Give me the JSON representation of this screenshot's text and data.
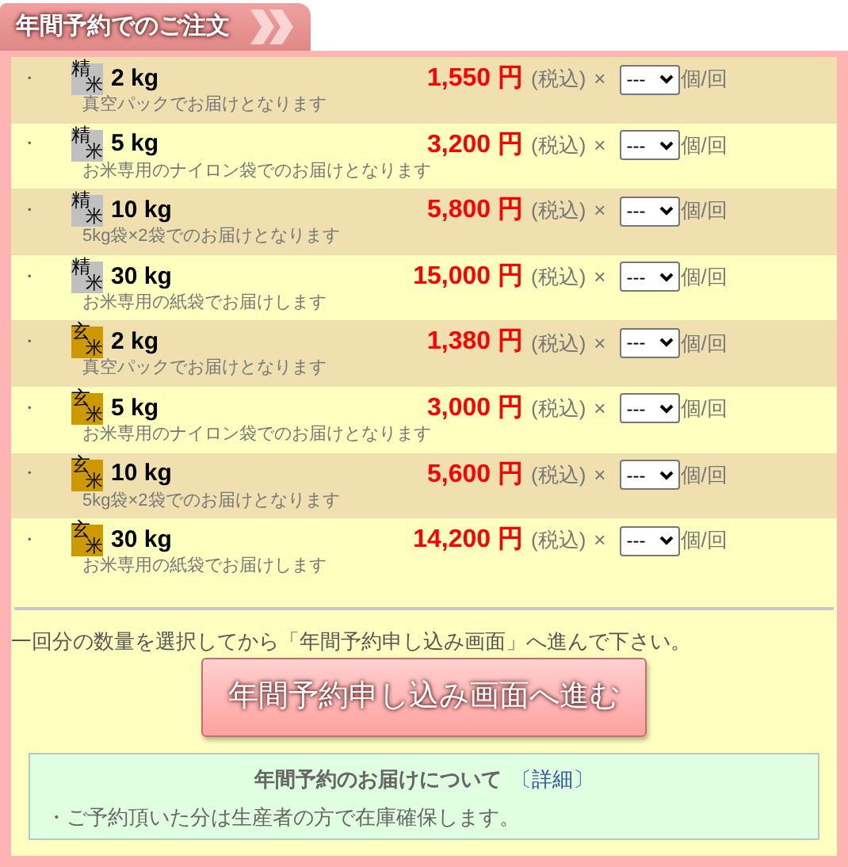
{
  "title": "年間予約でのご注文",
  "items": [
    {
      "bullet": "・",
      "kind": "polished",
      "badge": [
        "精",
        "米"
      ],
      "weight": "2 kg",
      "price": "1,550 円",
      "tax": "(税込)",
      "times": "×",
      "quantity": "---",
      "unit": "個/回",
      "note": "真空パックでお届けとなります"
    },
    {
      "bullet": "・",
      "kind": "polished",
      "badge": [
        "精",
        "米"
      ],
      "weight": "5 kg",
      "price": "3,200 円",
      "tax": "(税込)",
      "times": "×",
      "quantity": "---",
      "unit": "個/回",
      "note": "お米専用のナイロン袋でのお届けとなります"
    },
    {
      "bullet": "・",
      "kind": "polished",
      "badge": [
        "精",
        "米"
      ],
      "weight": "10 kg",
      "price": "5,800 円",
      "tax": "(税込)",
      "times": "×",
      "quantity": "---",
      "unit": "個/回",
      "note": "5kg袋×2袋でのお届けとなります"
    },
    {
      "bullet": "・",
      "kind": "polished",
      "badge": [
        "精",
        "米"
      ],
      "weight": "30 kg",
      "price": "15,000 円",
      "tax": "(税込)",
      "times": "×",
      "quantity": "---",
      "unit": "個/回",
      "note": "お米専用の紙袋でお届けします"
    },
    {
      "bullet": "・",
      "kind": "brown",
      "badge": [
        "玄",
        "米"
      ],
      "weight": "2 kg",
      "price": "1,380 円",
      "tax": "(税込)",
      "times": "×",
      "quantity": "---",
      "unit": "個/回",
      "note": "真空パックでお届けとなります"
    },
    {
      "bullet": "・",
      "kind": "brown",
      "badge": [
        "玄",
        "米"
      ],
      "weight": "5 kg",
      "price": "3,000 円",
      "tax": "(税込)",
      "times": "×",
      "quantity": "---",
      "unit": "個/回",
      "note": "お米専用のナイロン袋でのお届けとなります"
    },
    {
      "bullet": "・",
      "kind": "brown",
      "badge": [
        "玄",
        "米"
      ],
      "weight": "10 kg",
      "price": "5,600 円",
      "tax": "(税込)",
      "times": "×",
      "quantity": "---",
      "unit": "個/回",
      "note": "5kg袋×2袋でのお届けとなります"
    },
    {
      "bullet": "・",
      "kind": "brown",
      "badge": [
        "玄",
        "米"
      ],
      "weight": "30 kg",
      "price": "14,200 円",
      "tax": "(税込)",
      "times": "×",
      "quantity": "---",
      "unit": "個/回",
      "note": "お米専用の紙袋でお届けします"
    }
  ],
  "instruction": "一回分の数量を選択してから「年間予約申し込み画面」へ進んで下さい。",
  "proceed_button": "年間予約申し込み画面へ進む",
  "info": {
    "title": "年間予約のお届けについて",
    "link": "〔詳細〕",
    "text": "・ご予約頂いた分は生産者の方で在庫確保します。"
  }
}
